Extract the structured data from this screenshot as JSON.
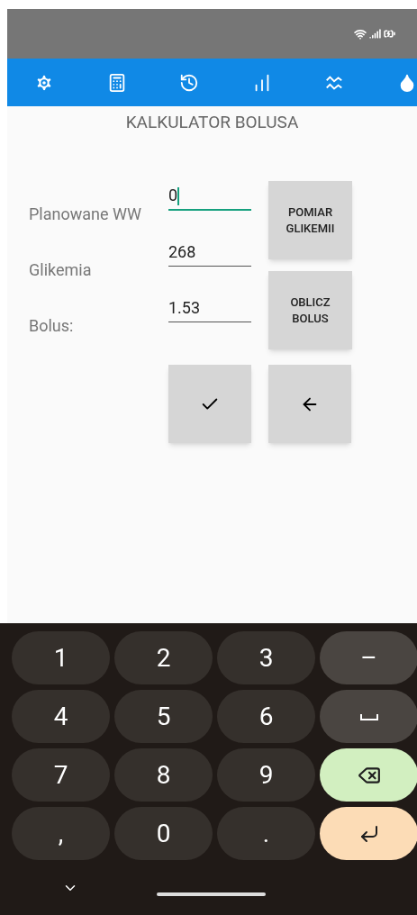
{
  "toolbar": {
    "tabs": [
      {
        "kind": "settings"
      },
      {
        "kind": "calculator"
      },
      {
        "kind": "history"
      },
      {
        "kind": "add-chart"
      },
      {
        "kind": "waves"
      },
      {
        "kind": "drop"
      }
    ]
  },
  "title": "KALKULATOR BOLUSA",
  "fields": [
    {
      "label": "Planowane WW",
      "value": "0",
      "focused": true
    },
    {
      "label": "Glikemia",
      "value": "268",
      "focused": false
    },
    {
      "label": "Bolus:",
      "value": "1.53",
      "focused": false
    }
  ],
  "side_buttons": [
    "POMIAR GLIKEMII",
    "OBLICZ BOLUS"
  ],
  "action_buttons": [
    {
      "kind": "confirm"
    },
    {
      "kind": "back"
    }
  ],
  "keyboard": {
    "keys": [
      {
        "kind": "digit",
        "label": "1"
      },
      {
        "kind": "digit",
        "label": "2"
      },
      {
        "kind": "digit",
        "label": "3"
      },
      {
        "kind": "symbol",
        "label": "–"
      },
      {
        "kind": "digit",
        "label": "4"
      },
      {
        "kind": "digit",
        "label": "5"
      },
      {
        "kind": "digit",
        "label": "6"
      },
      {
        "kind": "space"
      },
      {
        "kind": "digit",
        "label": "7"
      },
      {
        "kind": "digit",
        "label": "8"
      },
      {
        "kind": "digit",
        "label": "9"
      },
      {
        "kind": "backspace"
      },
      {
        "kind": "digit",
        "label": ","
      },
      {
        "kind": "digit",
        "label": "0"
      },
      {
        "kind": "digit",
        "label": "."
      },
      {
        "kind": "enter"
      }
    ]
  }
}
